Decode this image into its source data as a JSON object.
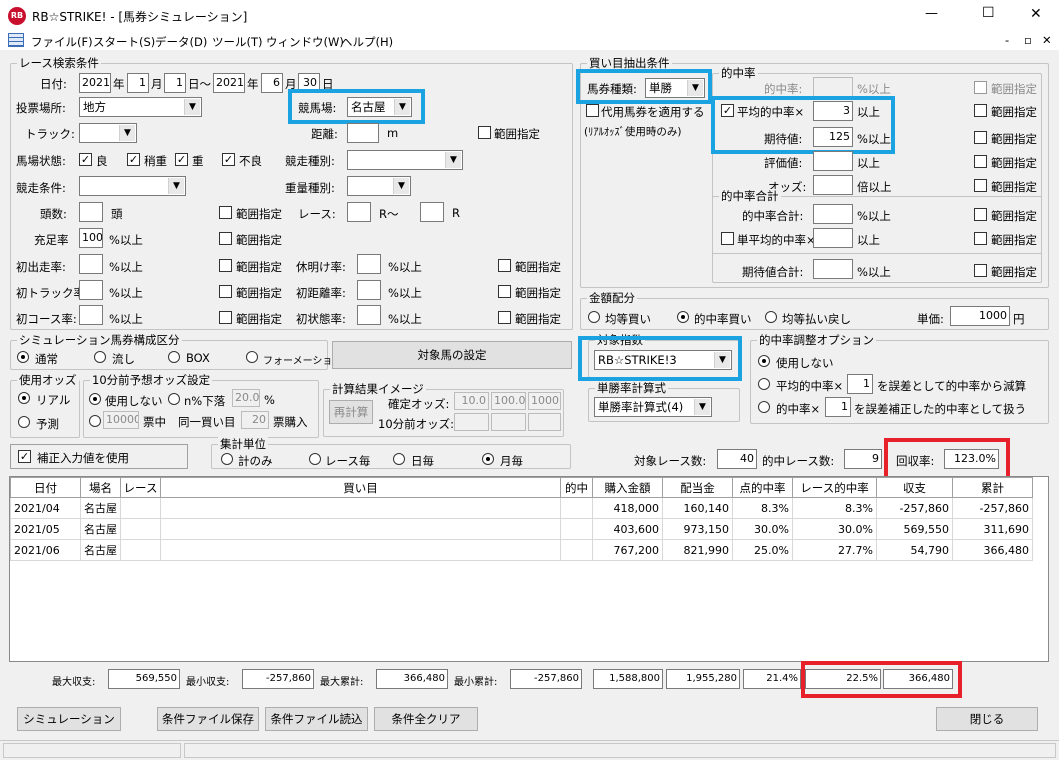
{
  "window": {
    "app_icon": "RB",
    "title": "RB☆STRIKE! - [馬券シミュレーション]",
    "minimize": "—",
    "maximize": "☐",
    "close": "✕"
  },
  "menu": {
    "items": [
      "ファイル(F)",
      "スタート(S)",
      "データ(D)",
      "ツール(T)",
      "ウィンドウ(W)",
      "ヘルプ(H)"
    ],
    "mdi": [
      "-",
      "▫",
      "✕"
    ]
  },
  "race": {
    "title": "レース検索条件",
    "date_label": "日付:",
    "y1": "2021",
    "ylab1": "年",
    "m1": "1",
    "mlab1": "月",
    "d1": "1",
    "dlab1": "日〜",
    "y2": "2021",
    "ylab2": "年",
    "m2": "6",
    "mlab2": "月",
    "d2": "30",
    "dlab2": "日",
    "venue_label": "投票場所:",
    "venue": "地方",
    "track_label": "競馬場:",
    "track": "名古屋",
    "trak_label": "トラック:",
    "trak": "",
    "distance_label": "距離:",
    "distance_unit": "m",
    "range": "範囲指定",
    "cond_label": "馬場状態:",
    "c1": "良",
    "c2": "稍重",
    "c3": "重",
    "c4": "不良",
    "type_label": "競走種別:",
    "race_cond_label": "競走条件:",
    "weight_label": "重量種別:",
    "heads_label": "頭数:",
    "heads_unit": "頭",
    "race_label": "レース:",
    "race_r": "R〜",
    "race_r2": "R",
    "fill_label": "充足率",
    "fill": "100",
    "fill_unit": "%以上",
    "r1a": "初出走率:",
    "r1b": "%以上",
    "r1c": "休明け率:",
    "r1d": "%以上",
    "r2a": "初トラック率:",
    "r2b": "%以上",
    "r2c": "初距離率:",
    "r2d": "%以上",
    "r3a": "初コース率:",
    "r3b": "%以上",
    "r3c": "初状態率:",
    "r3d": "%以上"
  },
  "sim": {
    "title": "シミュレーション馬券構成区分",
    "o1": "通常",
    "o2": "流し",
    "o3": "BOX",
    "o4": "フォーメーション",
    "target_btn": "対象馬の設定"
  },
  "odds": {
    "title": "使用オッズ",
    "o1": "リアル",
    "o2": "予測"
  },
  "pre": {
    "title": "10分前予想オッズ設定",
    "o1": "使用しない",
    "o2": "n%下落",
    "pct": "20.0",
    "pct_unit": "%",
    "v": "10000",
    "l1": "票中",
    "l2": "同一買い目",
    "n": "20",
    "l3": "票購入"
  },
  "calc": {
    "title": "計算結果イメージ",
    "recalc": "再計算",
    "l1": "確定オッズ:",
    "v1": "10.0",
    "v2": "100.0",
    "v3": "1000",
    "l2": "10分前オッズ:"
  },
  "hosei": {
    "label": "補正入力値を使用"
  },
  "agg": {
    "title": "集計単位",
    "o1": "計のみ",
    "o2": "レース毎",
    "o3": "日毎",
    "o4": "月毎"
  },
  "buy": {
    "title": "買い目抽出条件",
    "kind_label": "馬券種類:",
    "kind": "単勝",
    "proxy": "代用馬券を適用する",
    "proxy2": "(ﾘｱﾙｵｯｽﾞ使用時のみ)",
    "hit_title": "的中率",
    "hit_label": "的中率:",
    "hit_unit": "%以上",
    "avg_label": "平均的中率×",
    "avg": "3",
    "avg_unit": "以上",
    "exp_label": "期待値:",
    "exp": "125",
    "exp_unit": "%以上",
    "eval_label": "評価値:",
    "eval_unit": "以上",
    "odds_label": "オッズ:",
    "odds_unit": "倍以上",
    "range": "範囲指定",
    "sum_title": "的中率合計",
    "sum_label": "的中率合計:",
    "sum_unit": "%以上",
    "single_label": "単平均的中率×",
    "single_unit": "以上",
    "expsum_label": "期待値合計:",
    "expsum_unit": "%以上"
  },
  "money": {
    "title": "金額配分",
    "o1": "均等買い",
    "o2": "的中率買い",
    "o3": "均等払い戻し",
    "unit_label": "単価:",
    "unit": "1000",
    "unit_suffix": "円"
  },
  "index": {
    "title": "対象指数",
    "value": "RB☆STRIKE!3"
  },
  "tanshou": {
    "title": "単勝率計算式",
    "value": "単勝率計算式(4)"
  },
  "adj": {
    "title": "的中率調整オプション",
    "o1": "使用しない",
    "o2a": "平均的中率×",
    "o2v": "1",
    "o2b": "を誤差として的中率から減算",
    "o3a": "的中率×",
    "o3v": "1",
    "o3b": "を誤差補正した的中率として扱う"
  },
  "stats": {
    "races_label": "対象レース数:",
    "races": "40",
    "hits_label": "的中レース数:",
    "hits": "9",
    "rate_label": "回収率:",
    "rate": "123.0%"
  },
  "table": {
    "headers": [
      "日付",
      "場名",
      "レース",
      "買い目",
      "的中",
      "購入金額",
      "配当金",
      "点的中率",
      "レース的中率",
      "収支",
      "累計"
    ],
    "rows": [
      [
        "2021/04",
        "名古屋",
        "",
        "",
        "",
        "418,000",
        "160,140",
        "8.3%",
        "8.3%",
        "-257,860",
        "-257,860"
      ],
      [
        "2021/05",
        "名古屋",
        "",
        "",
        "",
        "403,600",
        "973,150",
        "30.0%",
        "30.0%",
        "569,550",
        "311,690"
      ],
      [
        "2021/06",
        "名古屋",
        "",
        "",
        "",
        "767,200",
        "821,990",
        "25.0%",
        "27.7%",
        "54,790",
        "366,480"
      ]
    ]
  },
  "footer": {
    "maxp_label": "最大収支:",
    "maxp": "569,550",
    "minp_label": "最小収支:",
    "minp": "-257,860",
    "maxc_label": "最大累計:",
    "maxc": "366,480",
    "minc_label": "最小累計:",
    "minc": "-257,860",
    "buy": "1,588,800",
    "pay": "1,955,280",
    "hit": "21.4%",
    "rhit": "22.5%",
    "total": "366,480"
  },
  "buttons": {
    "sim": "シミュレーション",
    "save": "条件ファイル保存",
    "load": "条件ファイル読込",
    "clear": "条件全クリア",
    "close": "閉じる"
  },
  "accent": {
    "highlight_blue": "#1aa3e0",
    "highlight_red": "#e8202a"
  }
}
